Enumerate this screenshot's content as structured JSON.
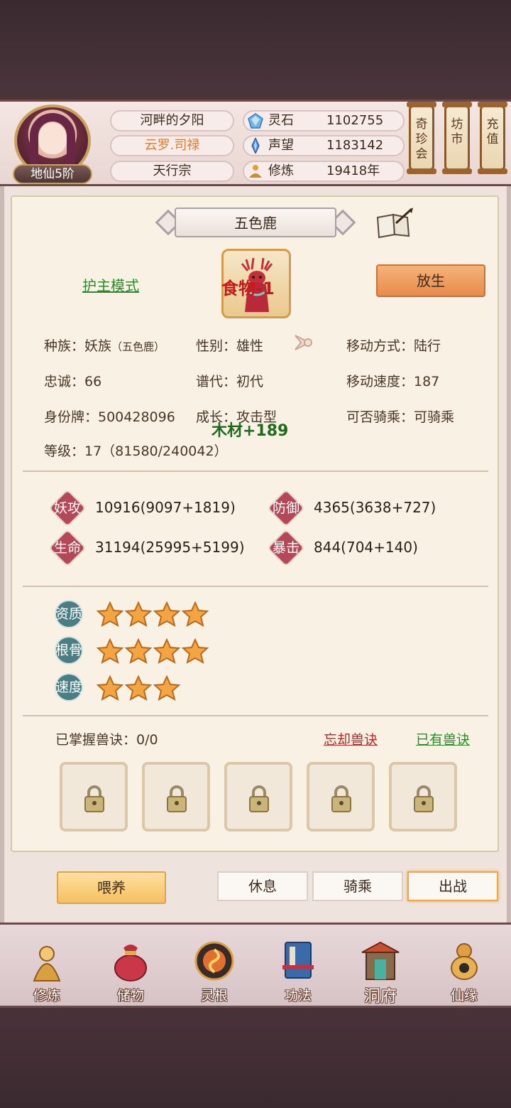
{
  "header": {
    "rank": "地仙5阶",
    "player_name": "河畔的夕阳",
    "title": "云罗.司禄",
    "sect": "天行宗",
    "resources": [
      {
        "icon": "spirit-stone-icon",
        "label": "灵石",
        "value": "1102755"
      },
      {
        "icon": "reputation-icon",
        "label": "声望",
        "value": "1183142"
      },
      {
        "icon": "cultivation-icon",
        "label": "修炼",
        "value": "19418年"
      }
    ],
    "shortcuts": [
      {
        "label": "奇珍会"
      },
      {
        "label": "坊市"
      },
      {
        "label": "充值"
      }
    ]
  },
  "pet": {
    "name": "五色鹿",
    "mode_link": "护主模式",
    "release_button": "放生",
    "float_food": "食物-1",
    "float_wood": "木材+189",
    "info": {
      "race": "种族：妖族",
      "race_detail": "（五色鹿）",
      "gender": "性别：雄性",
      "move_type": "移动方式：陆行",
      "loyalty": "忠诚：66",
      "generation": "谱代：初代",
      "move_speed": "移动速度：187",
      "id_tag": "身份牌：500428096",
      "growth": "成长：攻击型",
      "rideable": "可否骑乘：可骑乘",
      "level": "等级：17（81580/240042）"
    },
    "stats": [
      {
        "label": "妖攻",
        "value": "10916(9097+1819)"
      },
      {
        "label": "防御",
        "value": "4365(3638+727)"
      },
      {
        "label": "生命",
        "value": "31194(25995+5199)"
      },
      {
        "label": "暴击",
        "value": "844(704+140)"
      }
    ],
    "aptitudes": [
      {
        "label": "资质",
        "stars": 4
      },
      {
        "label": "根骨",
        "stars": 4
      },
      {
        "label": "速度",
        "stars": 3
      }
    ],
    "skills": {
      "label": "已掌握兽诀：0/0",
      "forget_link": "忘却兽诀",
      "owned_link": "已有兽诀",
      "slots": 5
    }
  },
  "actions": {
    "feed": "喂养",
    "rest": "休息",
    "ride": "骑乘",
    "battle": "出战",
    "active": "出战"
  },
  "nav": [
    {
      "label": "修炼",
      "icon": "meditation-icon"
    },
    {
      "label": "储物",
      "icon": "bag-icon"
    },
    {
      "label": "灵根",
      "icon": "spirit-root-icon"
    },
    {
      "label": "功法",
      "icon": "book-icon"
    },
    {
      "label": "洞府",
      "icon": "cave-palace-icon"
    },
    {
      "label": "仙缘",
      "icon": "gourd-icon"
    }
  ],
  "colors": {
    "accent_orange": "#e98a4a",
    "link_green": "#2e8a2e",
    "link_red": "#b22a2a",
    "star_gold": "#f3a443"
  }
}
